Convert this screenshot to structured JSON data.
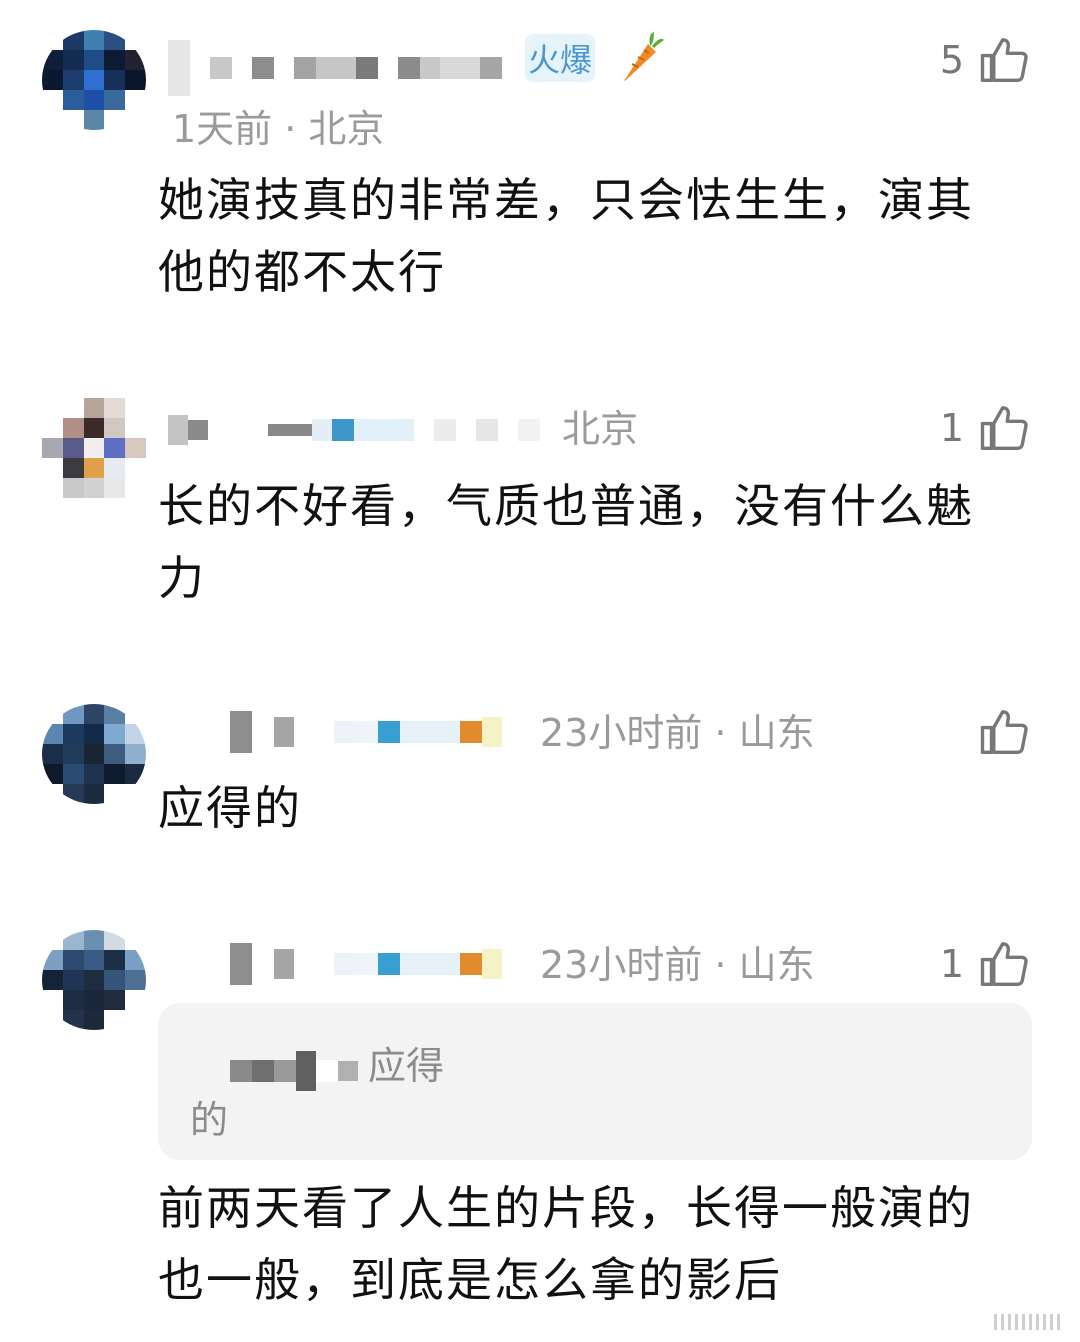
{
  "comments": [
    {
      "meta": "1天前 · 北京",
      "badge": "火爆",
      "text": "她演技真的非常差，只会怯生生，演其他的都不太行",
      "likes": "5"
    },
    {
      "meta": "北京",
      "text": "长的不好看，气质也普通，没有什么魅力",
      "likes": "1"
    },
    {
      "meta": "23小时前 · 山东",
      "text": "应得的",
      "likes": ""
    },
    {
      "meta": "23小时前 · 山东",
      "quote_text": "应得",
      "quote_tail": "的",
      "text": "前两天看了人生的片段，长得一般演的也一般，到底是怎么拿的影后",
      "likes": "1"
    }
  ],
  "colors": {
    "meta": "#9a9a9a",
    "text": "#111111",
    "quote_bg": "#f3f3f3",
    "badge_bg": "#e7f3fb",
    "badge_text": "#4a98cf"
  },
  "icons": {
    "like": "thumbs-up-icon",
    "decor": "carrot-icon"
  }
}
